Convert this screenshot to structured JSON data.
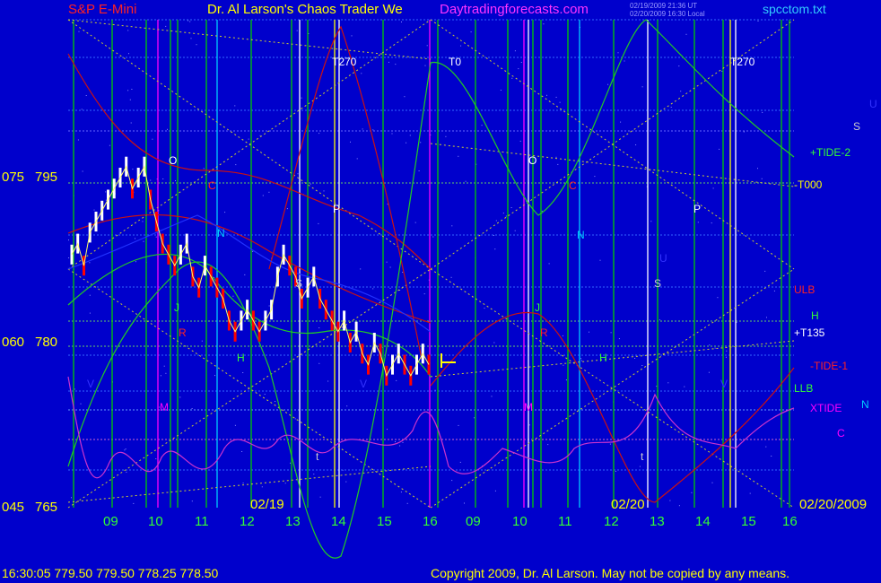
{
  "header": {
    "instrument": "S&P E-Mini",
    "title": "Dr. Al Larson's Chaos Trader We",
    "site": "Daytradingforecasts.com",
    "stamp_line_1": "02/19/2009 21:36 UT",
    "stamp_line_2": "02/20/2009 16:30 Local",
    "file": "spcctom.txt"
  },
  "footer": {
    "quote": "16:30:05  779.50 779.50 778.25 778.50",
    "copyright": "Copyright 2009, Dr. Al Larson. May not be copied by any means."
  },
  "colors": {
    "background": "#0000cc",
    "price_up": "#ffffff",
    "price_down": "#ff0000",
    "grid_green": "#00cc00",
    "forecast_yellow": "#ffff00",
    "magenta": "#ff00ff",
    "label_yellow": "#ffff00"
  },
  "chart_data": {
    "type": "line",
    "title": "S&P E-Mini",
    "y_axis": {
      "ticks_left": [
        "075",
        "060",
        "045"
      ],
      "ticks_right": [
        "795",
        "780",
        "765"
      ],
      "ylim": [
        765,
        805
      ]
    },
    "x_axis": {
      "hour_ticks": [
        "09",
        "10",
        "11",
        "12",
        "13",
        "14",
        "15",
        "16",
        "09",
        "10",
        "11",
        "12",
        "13",
        "14",
        "15",
        "16"
      ],
      "date_labels": [
        "02/19",
        "02/20",
        "02/20/2009"
      ]
    },
    "right_labels": [
      {
        "text": "U",
        "color": "#3333ff"
      },
      {
        "text": "S",
        "color": "#cccccc"
      },
      {
        "text": "+TIDE-2",
        "color": "#33ff33"
      },
      {
        "text": "-T000",
        "color": "#ffff00"
      },
      {
        "text": "ULB",
        "color": "#ff2222"
      },
      {
        "text": "H",
        "color": "#33ff33"
      },
      {
        "text": "+T135",
        "color": "#ffffff"
      },
      {
        "text": "-TIDE-1",
        "color": "#ff2222"
      },
      {
        "text": "LLB",
        "color": "#33ff33"
      },
      {
        "text": "N",
        "color": "#00ccff"
      },
      {
        "text": "XTIDE",
        "color": "#ff00ff"
      },
      {
        "text": "C",
        "color": "#ff00ff"
      }
    ],
    "plot_labels": [
      {
        "text": "T270",
        "color": "#ffffff"
      },
      {
        "text": "T0",
        "color": "#ffffff"
      },
      {
        "text": "T270",
        "color": "#ffffff"
      },
      {
        "text": "O",
        "color": "#ffffff"
      },
      {
        "text": "O",
        "color": "#ffffff"
      },
      {
        "text": "C",
        "color": "#ff2222"
      },
      {
        "text": "C",
        "color": "#ff2222"
      },
      {
        "text": "P",
        "color": "#ffffff"
      },
      {
        "text": "P",
        "color": "#ffffff"
      },
      {
        "text": "N",
        "color": "#00ccff"
      },
      {
        "text": "N",
        "color": "#00ccff"
      },
      {
        "text": "U",
        "color": "#3333ff"
      },
      {
        "text": "S",
        "color": "#cccccc"
      },
      {
        "text": "S",
        "color": "#cccccc"
      },
      {
        "text": "J",
        "color": "#33ff33"
      },
      {
        "text": "J",
        "color": "#33ff33"
      },
      {
        "text": "R",
        "color": "#ff2222"
      },
      {
        "text": "R",
        "color": "#ff2222"
      },
      {
        "text": "H",
        "color": "#33ff33"
      },
      {
        "text": "H",
        "color": "#33ff33"
      },
      {
        "text": "V",
        "color": "#3333ff"
      },
      {
        "text": "V",
        "color": "#3333ff"
      },
      {
        "text": "V",
        "color": "#3333ff"
      },
      {
        "text": "M",
        "color": "#ff00ff"
      },
      {
        "text": "M",
        "color": "#ff00ff"
      },
      {
        "text": "t",
        "color": "#cccccc"
      },
      {
        "text": "t",
        "color": "#cccccc"
      }
    ],
    "series": [
      {
        "values": [
          788,
          789,
          787,
          790,
          791,
          792,
          793,
          794,
          795,
          796,
          794,
          795,
          796,
          793,
          791,
          789,
          788,
          787,
          788,
          789,
          786,
          785,
          787,
          786,
          785,
          784,
          782,
          781,
          782,
          783,
          782,
          781,
          782,
          783,
          786,
          788,
          787,
          786,
          784,
          785,
          786,
          784,
          783,
          782,
          781,
          782,
          780,
          781,
          779,
          778,
          780,
          779,
          777,
          778,
          779,
          778,
          777,
          778,
          779,
          778
        ]
      }
    ]
  }
}
